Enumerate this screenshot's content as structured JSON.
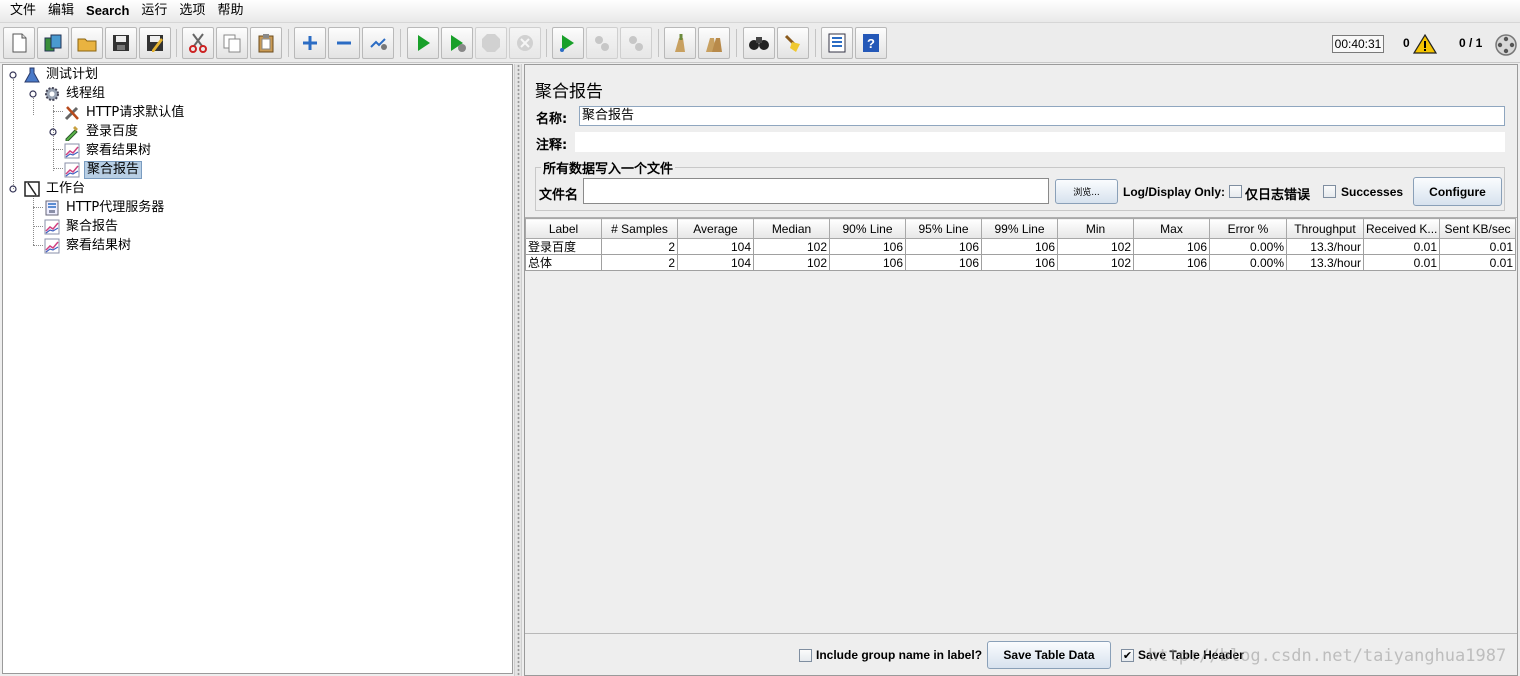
{
  "menu": [
    "文件",
    "编辑",
    "Search",
    "运行",
    "选项",
    "帮助"
  ],
  "toolbar": {
    "icons": [
      "new-icon",
      "templates-icon",
      "open-icon",
      "save-icon",
      "save-as-icon",
      "cut-icon",
      "copy-icon",
      "paste-icon",
      "expand-icon",
      "collapse-icon",
      "toggle-icon",
      "start-icon",
      "start-no-pause-icon",
      "stop-icon",
      "shutdown-icon",
      "remote-start-icon",
      "remote-stop-icon",
      "remote-shutdown-icon",
      "clear-icon",
      "clear-all-icon",
      "search-icon",
      "reset-search-icon",
      "function-helper-icon",
      "help-icon"
    ],
    "timer": "00:40:31",
    "error_count": "0",
    "threads": "0 / 1"
  },
  "tree": {
    "test_plan": "测试计划",
    "thread_group": "线程组",
    "http_defaults": "HTTP请求默认值",
    "login_sampler": "登录百度",
    "view_results_tree": "察看结果树",
    "aggregate_report": "聚合报告",
    "workbench": "工作台",
    "http_proxy": "HTTP代理服务器",
    "wb_aggregate_report": "聚合报告",
    "wb_view_results_tree": "察看结果树"
  },
  "panel": {
    "title": "聚合报告",
    "name_label": "名称:",
    "name_value": "聚合报告",
    "comment_label": "注释:",
    "comment_value": "",
    "file_group_title": "所有数据写入一个文件",
    "file_label": "文件名",
    "file_value": "",
    "browse_label": "浏览...",
    "log_display_label": "Log/Display Only:",
    "errors_only_label": "仅日志错误",
    "successes_label": "Successes",
    "configure_label": "Configure"
  },
  "table": {
    "headers": [
      "Label",
      "# Samples",
      "Average",
      "Median",
      "90% Line",
      "95% Line",
      "99% Line",
      "Min",
      "Max",
      "Error %",
      "Throughput",
      "Received K...",
      "Sent KB/sec"
    ],
    "rows": [
      [
        "登录百度",
        "2",
        "104",
        "102",
        "106",
        "106",
        "106",
        "102",
        "106",
        "0.00%",
        "13.3/hour",
        "0.01",
        "0.01"
      ],
      [
        "总体",
        "2",
        "104",
        "102",
        "106",
        "106",
        "106",
        "102",
        "106",
        "0.00%",
        "13.3/hour",
        "0.01",
        "0.01"
      ]
    ]
  },
  "bottom": {
    "include_group_label": "Include group name in label?",
    "include_group_checked": false,
    "save_table_data_label": "Save Table Data",
    "save_table_header_label": "Save Table Header",
    "save_table_header_checked": true
  },
  "watermark": "http://blog.csdn.net/taiyanghua1987"
}
